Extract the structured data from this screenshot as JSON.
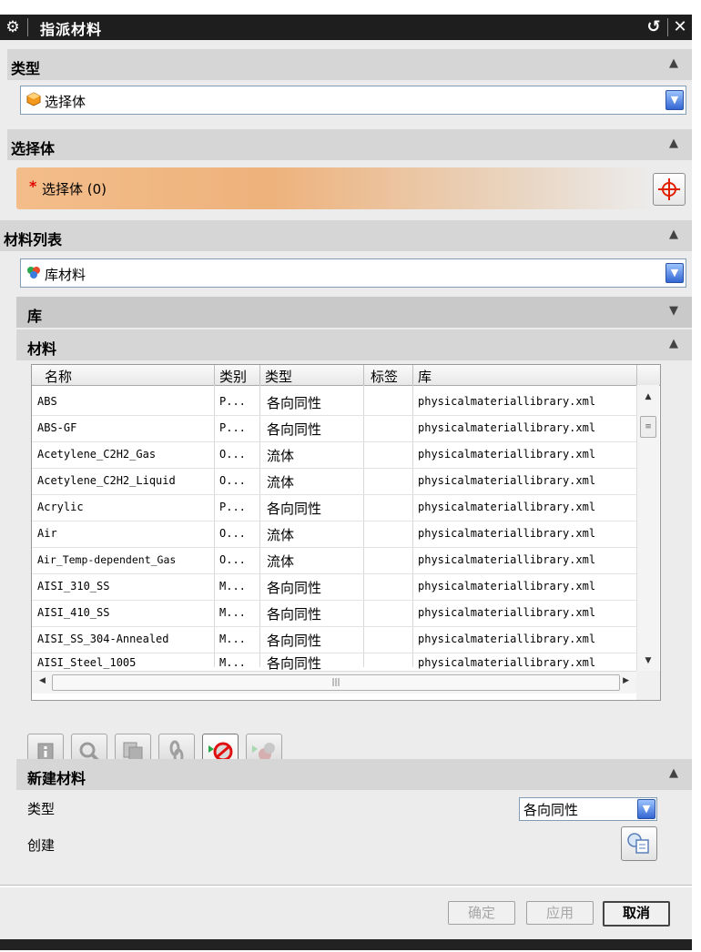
{
  "window": {
    "title": "指派材料"
  },
  "type_section": {
    "header": "类型",
    "selected": "选择体"
  },
  "select_body_section": {
    "header": "选择体",
    "prompt": "选择体 (0)"
  },
  "material_list_section": {
    "header": "材料列表",
    "source": "库材料",
    "library_header": "库",
    "materials_header": "材料",
    "columns": [
      "名称",
      "类别",
      "类型",
      "标签",
      "库"
    ],
    "rows": [
      {
        "name": "ABS",
        "category": "P...",
        "type": "各向同性",
        "tag": "",
        "library": "physicalmateriallibrary.xml"
      },
      {
        "name": "ABS-GF",
        "category": "P...",
        "type": "各向同性",
        "tag": "",
        "library": "physicalmateriallibrary.xml"
      },
      {
        "name": "Acetylene_C2H2_Gas",
        "category": "O...",
        "type": "流体",
        "tag": "",
        "library": "physicalmateriallibrary.xml"
      },
      {
        "name": "Acetylene_C2H2_Liquid",
        "category": "O...",
        "type": "流体",
        "tag": "",
        "library": "physicalmateriallibrary.xml"
      },
      {
        "name": "Acrylic",
        "category": "P...",
        "type": "各向同性",
        "tag": "",
        "library": "physicalmateriallibrary.xml"
      },
      {
        "name": "Air",
        "category": "O...",
        "type": "流体",
        "tag": "",
        "library": "physicalmateriallibrary.xml"
      },
      {
        "name": "Air_Temp-dependent_Gas",
        "category": "O...",
        "type": "流体",
        "tag": "",
        "library": "physicalmateriallibrary.xml"
      },
      {
        "name": "AISI_310_SS",
        "category": "M...",
        "type": "各向同性",
        "tag": "",
        "library": "physicalmateriallibrary.xml"
      },
      {
        "name": "AISI_410_SS",
        "category": "M...",
        "type": "各向同性",
        "tag": "",
        "library": "physicalmateriallibrary.xml"
      },
      {
        "name": "AISI_SS_304-Annealed",
        "category": "M...",
        "type": "各向同性",
        "tag": "",
        "library": "physicalmateriallibrary.xml"
      },
      {
        "name": "AISI_Steel_1005",
        "category": "M...",
        "type": "各向同性",
        "tag": "",
        "library": "physicalmateriallibrary.xml"
      }
    ]
  },
  "new_material_section": {
    "header": "新建材料",
    "type_label": "类型",
    "type_value": "各向同性",
    "create_label": "创建"
  },
  "footer": {
    "ok": "确定",
    "apply": "应用",
    "cancel": "取消"
  },
  "colors": {
    "accent": "#3466d2",
    "selection_gradient": "#f3bd8a",
    "required_star": "#e00000"
  }
}
